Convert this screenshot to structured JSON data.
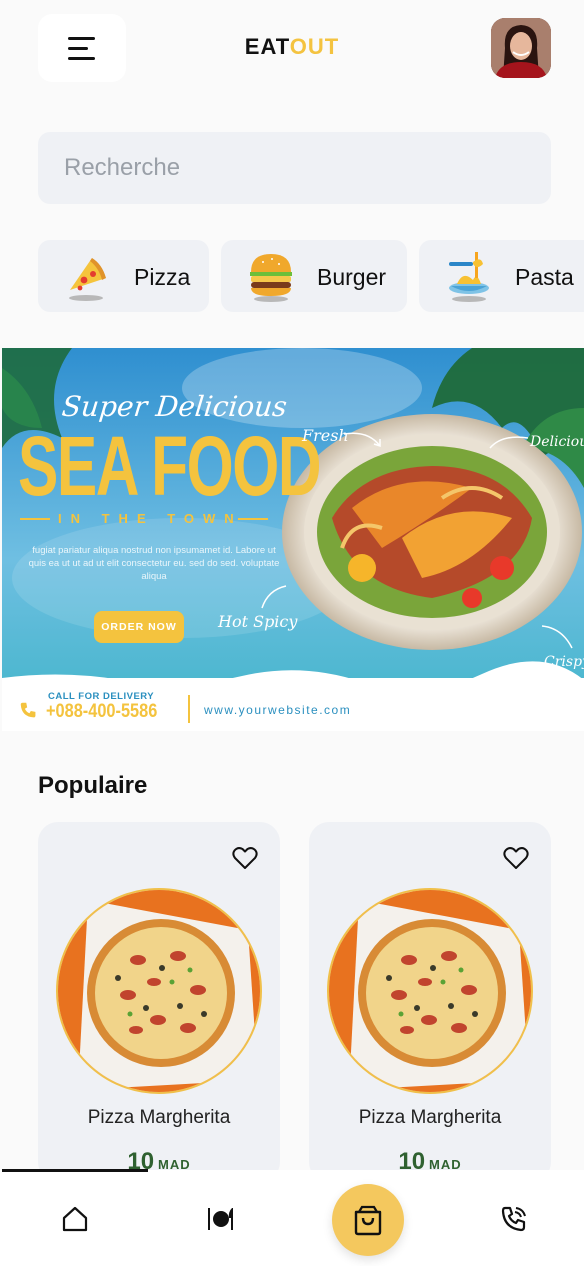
{
  "header": {
    "logo_part1": "EAT",
    "logo_part2": "OUT",
    "menu_icon": "hamburger-menu-icon",
    "avatar": "user-avatar"
  },
  "search": {
    "placeholder": "Recherche",
    "value": ""
  },
  "categories": [
    {
      "label": "Pizza",
      "icon": "pizza-icon"
    },
    {
      "label": "Burger",
      "icon": "burger-icon"
    },
    {
      "label": "Pasta",
      "icon": "pasta-icon"
    }
  ],
  "banner": {
    "headline_top": "Super Delicious",
    "headline_main": "SEA FOOD",
    "tagline": "IN THE TOWN",
    "body": "fugiat pariatur aliqua nostrud non ipsumamet id. Labore ut quis ea ut ut ad ut elit consectetur eu. sed do sed. voluptate aliqua",
    "cta": "ORDER NOW",
    "callout_fresh": "Fresh",
    "callout_delicious": "Delicious",
    "callout_hot": "Hot Spicy",
    "callout_crispy": "Crispy",
    "call_label": "CALL FOR DELIVERY",
    "phone": "+088-400-5586",
    "website": "www.yourwebsite.com"
  },
  "popular": {
    "title": "Populaire",
    "items": [
      {
        "name": "Pizza Margherita",
        "price": "10",
        "currency": "MAD"
      },
      {
        "name": "Pizza Margherita",
        "price": "10",
        "currency": "MAD"
      }
    ]
  },
  "nav": {
    "items": [
      "home-icon",
      "restaurant-icon",
      "cart-icon",
      "phone-icon"
    ]
  },
  "colors": {
    "accent": "#f4c340",
    "price": "#2f6130",
    "card_bg": "#eff1f5"
  }
}
